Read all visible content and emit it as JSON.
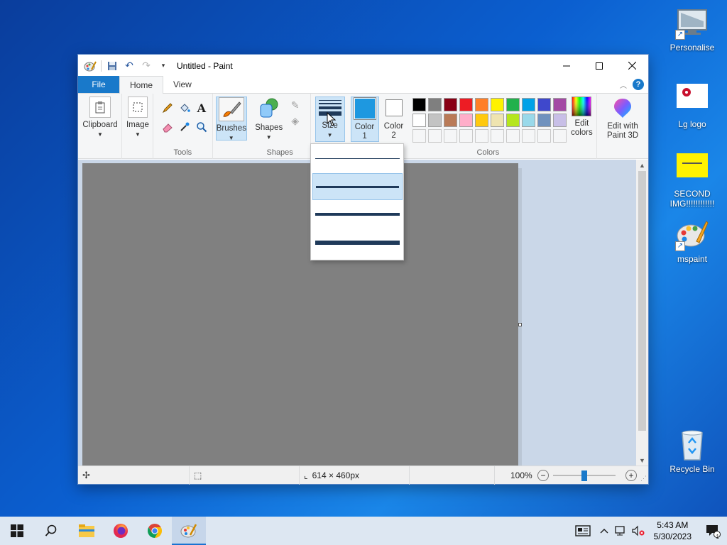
{
  "desktop": {
    "icons": [
      {
        "label": "Personalise",
        "icon": "monitor-icon"
      },
      {
        "label": "Lg logo",
        "icon": "image-file-icon"
      },
      {
        "label": "SECOND IMG!!!!!!!!!!!!",
        "icon": "image-file-icon"
      },
      {
        "label": "mspaint",
        "icon": "paint-palette-icon"
      },
      {
        "label": "Recycle Bin",
        "icon": "recycle-bin-icon"
      }
    ]
  },
  "window": {
    "title": "Untitled - Paint",
    "tabs": [
      {
        "label": "File"
      },
      {
        "label": "Home"
      },
      {
        "label": "View"
      }
    ],
    "help": "?"
  },
  "ribbon": {
    "clipboard": {
      "label": "Clipboard"
    },
    "image": {
      "label": "Image"
    },
    "tools": {
      "group_label": "Tools",
      "items": [
        "pencil-icon",
        "fill-icon",
        "text-icon",
        "eraser-icon",
        "color-picker-icon",
        "magnifier-icon"
      ]
    },
    "brushes": {
      "label": "Brushes"
    },
    "shapes": {
      "label": "Shapes",
      "group_label": "Shapes"
    },
    "size": {
      "label": "Size"
    },
    "color1": {
      "label_line1": "Color",
      "label_line2": "1",
      "value": "#1e98e0"
    },
    "color2": {
      "label_line1": "Color",
      "label_line2": "2",
      "value": "#ffffff"
    },
    "colors": {
      "group_label": "Colors",
      "row1": [
        "#000000",
        "#7f7f7f",
        "#880015",
        "#ed1c24",
        "#ff7f27",
        "#fff200",
        "#22b14c",
        "#00a2e8",
        "#3f48cc",
        "#a349a4"
      ],
      "row2": [
        "#ffffff",
        "#c3c3c3",
        "#b97a57",
        "#ffaec9",
        "#ffc90e",
        "#efe4b0",
        "#b5e61d",
        "#99d9ea",
        "#7092be",
        "#c8bfe7"
      ],
      "row3": [
        "#f5f6f7",
        "#f5f6f7",
        "#f5f6f7",
        "#f5f6f7",
        "#f5f6f7",
        "#f5f6f7",
        "#f5f6f7",
        "#f5f6f7",
        "#f5f6f7",
        "#f5f6f7"
      ]
    },
    "edit_colors": {
      "label_line1": "Edit",
      "label_line2": "colors"
    },
    "paint3d": {
      "label_line1": "Edit with",
      "label_line2": "Paint 3D"
    }
  },
  "size_dropdown": {
    "options": [
      {
        "thickness": 1,
        "selected": false
      },
      {
        "thickness": 3,
        "selected": true
      },
      {
        "thickness": 5,
        "selected": false
      },
      {
        "thickness": 8,
        "selected": false
      }
    ]
  },
  "canvas": {
    "color": "#808080"
  },
  "statusbar": {
    "dimensions": "614 × 460px",
    "zoom": "100%",
    "zoom_out": "−",
    "zoom_in": "+"
  },
  "taskbar": {
    "clock_time": "5:43 AM",
    "clock_date": "5/30/2023",
    "notification_count": "1",
    "apps": [
      "start-icon",
      "search-icon",
      "file-explorer-icon",
      "firefox-icon",
      "chrome-icon",
      "paint-icon"
    ]
  }
}
